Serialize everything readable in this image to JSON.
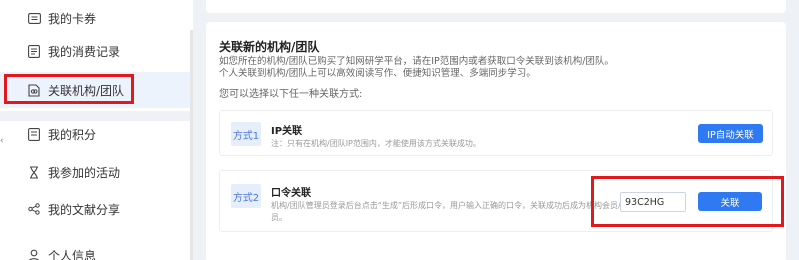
{
  "sidebar": {
    "items": [
      {
        "label": "我的卡券",
        "icon": "ticket-icon"
      },
      {
        "label": "我的消费记录",
        "icon": "receipt-icon"
      },
      {
        "label": "关联机构/团队",
        "icon": "link-icon"
      },
      {
        "label": "我的积分",
        "icon": "points-icon"
      },
      {
        "label": "我参加的活动",
        "icon": "activity-icon"
      },
      {
        "label": "我的文献分享",
        "icon": "share-icon"
      },
      {
        "label": "个人信息",
        "icon": "user-icon"
      }
    ],
    "active_index": 2
  },
  "main": {
    "title": "关联新的机构/团队",
    "desc_line1": "如您所在的机构/团队已购买了知网研学平台，请在IP范围内或者获取口令关联到该机构/团队。",
    "desc_line2": "个人关联到机构/团队上可以高效阅读写作、便捷知识管理、多端同步学习。",
    "choose_text": "您可以选择以下任一种关联方式:",
    "method1": {
      "badge": "方式1",
      "title": "IP关联",
      "note": "注：只有在机构/团队IP范围内，才能使用该方式关联成功。",
      "button": "IP自动关联"
    },
    "method2": {
      "badge": "方式2",
      "title": "口令关联",
      "note_line1": "机构/团队管理员登录后台点击“生成”后形成口令，用户输入正确的口令，关联成功后成为机构会员/团队",
      "note_line2": "员。",
      "input_value": "93C2HG",
      "button": "关联"
    }
  },
  "colors": {
    "accent": "#2f7af2",
    "highlight": "#e0191c"
  }
}
